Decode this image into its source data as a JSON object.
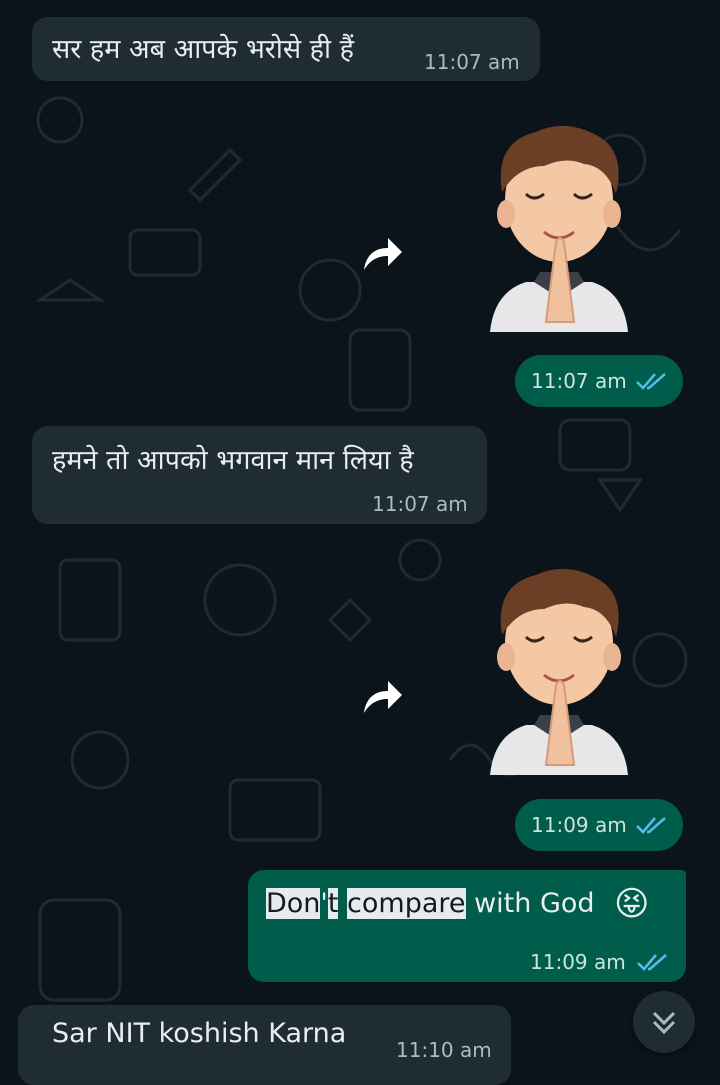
{
  "messages": [
    {
      "direction": "in",
      "text": "सर हम अब आपके भरोसे ही हैं",
      "time": "11:07 am"
    },
    {
      "direction": "out",
      "type": "sticker",
      "sticker_icon": "praying-boy-memoji-icon",
      "time": "11:07 am",
      "status": "read"
    },
    {
      "direction": "in",
      "text": "हमने तो आपको भगवान मान लिया है",
      "time": "11:07 am"
    },
    {
      "direction": "out",
      "type": "sticker",
      "sticker_icon": "praying-boy-memoji-icon",
      "time": "11:09 am",
      "status": "read"
    },
    {
      "direction": "out",
      "text_parts": [
        "Don",
        "'",
        "t",
        " ",
        "compare",
        " with God"
      ],
      "emoji": "😝",
      "time": "11:09 am",
      "status": "read"
    },
    {
      "direction": "in",
      "text": "Sar NIT koshish Karna",
      "time": "11:10 am"
    }
  ],
  "colors": {
    "background": "#0b141a",
    "incoming": "#202c33",
    "outgoing": "#005c4b",
    "read_ticks": "#53bdeb",
    "highlight": "#e6ecec"
  },
  "icons": {
    "forward": "forward-arrow-icon",
    "scroll": "double-chevron-down-icon",
    "read": "double-check-icon"
  }
}
